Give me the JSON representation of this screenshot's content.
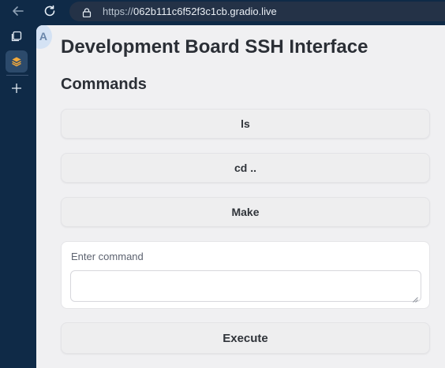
{
  "browser": {
    "url_protocol": "https://",
    "url_host": "062b111c6f52f3c1cb.gradio.live"
  },
  "sidebar": {
    "items": [
      {
        "icon": "tabs-icon"
      },
      {
        "icon": "app-icon",
        "active": true
      },
      {
        "icon": "plus-icon"
      }
    ]
  },
  "page": {
    "avatar_letter": "A",
    "title": "Development Board SSH Interface",
    "section_heading": "Commands",
    "buttons": {
      "ls": "ls",
      "cd": "cd ..",
      "make": "Make",
      "execute": "Execute"
    },
    "command": {
      "label": "Enter command",
      "value": "",
      "placeholder": ""
    }
  },
  "colors": {
    "chrome_background": "#0f2a47",
    "page_background": "#f0f0f2",
    "button_background": "#eeeeef",
    "active_sidebar_item": "#2c4a6b"
  }
}
